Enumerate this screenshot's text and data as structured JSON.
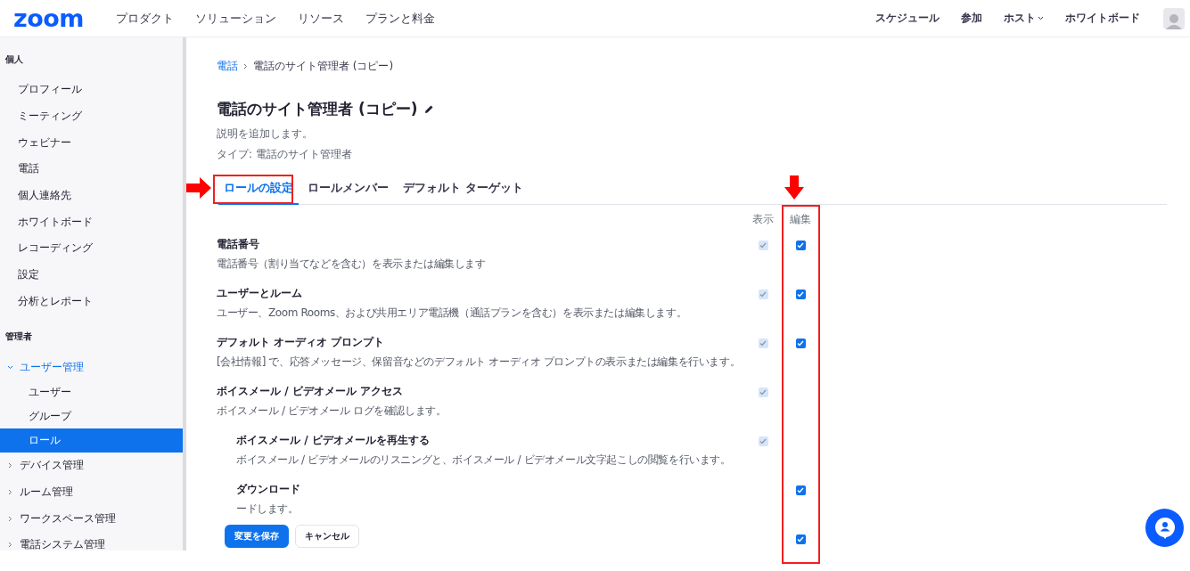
{
  "header": {
    "logo": "zoom",
    "nav": [
      "プロダクト",
      "ソリューション",
      "リソース",
      "プランと料金"
    ],
    "right_nav": [
      {
        "label": "スケジュール",
        "has_menu": false
      },
      {
        "label": "参加",
        "has_menu": false
      },
      {
        "label": "ホスト",
        "has_menu": true
      },
      {
        "label": "ホワイトボード",
        "has_menu": false
      }
    ]
  },
  "sidebar": {
    "sections": [
      {
        "heading": "個人",
        "items": [
          {
            "label": "プロフィール",
            "selected": false
          },
          {
            "label": "ミーティング",
            "selected": false
          },
          {
            "label": "ウェビナー",
            "selected": false
          },
          {
            "label": "電話",
            "selected": false
          },
          {
            "label": "個人連絡先",
            "selected": false
          },
          {
            "label": "ホワイトボード",
            "selected": false
          },
          {
            "label": "レコーディング",
            "selected": false
          },
          {
            "label": "設定",
            "selected": false
          },
          {
            "label": "分析とレポート",
            "selected": false
          }
        ]
      },
      {
        "heading": "管理者",
        "items": [
          {
            "label": "ユーザー管理",
            "selected": false,
            "expanded": true,
            "children": [
              {
                "label": "ユーザー",
                "selected": false
              },
              {
                "label": "グループ",
                "selected": false
              },
              {
                "label": "ロール",
                "selected": true
              }
            ]
          },
          {
            "label": "デバイス管理",
            "selected": false,
            "expanded": false
          },
          {
            "label": "ルーム管理",
            "selected": false,
            "expanded": false
          },
          {
            "label": "ワークスペース管理",
            "selected": false,
            "expanded": false
          },
          {
            "label": "電話システム管理",
            "selected": false,
            "expanded": false
          }
        ]
      }
    ]
  },
  "breadcrumb": [
    {
      "label": "電話",
      "link": true
    },
    {
      "label": "電話のサイト管理者 (コピー)",
      "link": false
    }
  ],
  "role": {
    "title": "電話のサイト管理者 (コピー)",
    "description": "説明を追加します。",
    "type": "タイプ: 電話のサイト管理者"
  },
  "tabs": [
    {
      "label": "ロールの設定",
      "selected": true
    },
    {
      "label": "ロールメンバー",
      "selected": false
    },
    {
      "label": "デフォルト ターゲット",
      "selected": false
    }
  ],
  "table": {
    "columns": [
      "表示",
      "編集"
    ],
    "permissions": [
      {
        "title": "電話番号",
        "description": "電話番号（割り当てなどを含む）を表示または編集します",
        "view": true,
        "edit": true
      },
      {
        "title": "ユーザーとルーム",
        "description": "ユーザー、Zoom Rooms、および共用エリア電話機（通話プランを含む）を表示または編集します。",
        "view": true,
        "edit": true
      },
      {
        "title": "デフォルト オーディオ プロンプト",
        "description": "[会社情報] で、応答メッセージ、保留音などのデフォルト オーディオ プロンプトの表示または編集を行います。",
        "view": true,
        "edit": true
      },
      {
        "title": "ボイスメール / ビデオメール アクセス",
        "description": "ボイスメール / ビデオメール ログを確認します。",
        "view": true,
        "edit": false,
        "children": [
          {
            "title": "ボイスメール / ビデオメールを再生する",
            "description": "ボイスメール / ビデオメールのリスニングと、ボイスメール / ビデオメール文字起こしの閲覧を行います。",
            "view": true,
            "edit": false
          },
          {
            "title": "ダウンロード",
            "description": "ードします。",
            "view": false,
            "edit": true
          },
          {
            "edit": true
          }
        ]
      }
    ]
  },
  "actions": {
    "save": "変更を保存",
    "cancel": "キャンセル"
  }
}
